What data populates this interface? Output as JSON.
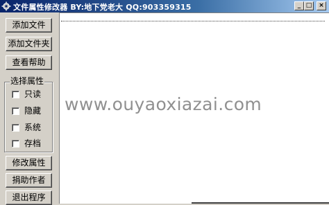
{
  "window": {
    "title": "文件属性修改器 BY:地下党老大 QQ:903359315",
    "min_label": "_",
    "max_label": "□",
    "close_label": "×"
  },
  "buttons": {
    "add_file": "添加文件",
    "add_folder": "添加文件夹",
    "help": "查看帮助",
    "modify": "修改属性",
    "donate": "捐助作者",
    "exit": "退出程序"
  },
  "attributes": {
    "group_title": "选择属性",
    "readonly": "只读",
    "hidden": "隐藏",
    "system": "系统",
    "archive": "存档"
  },
  "watermark": "www.ouyaoxiazai.com"
}
